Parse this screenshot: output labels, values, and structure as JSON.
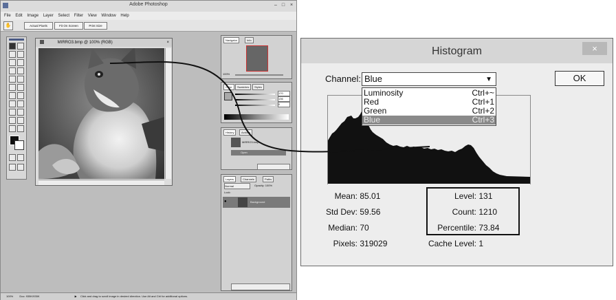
{
  "photoshop": {
    "title": "Adobe Photoshop",
    "menu": [
      "File",
      "Edit",
      "Image",
      "Layer",
      "Select",
      "Filter",
      "View",
      "Window",
      "Help"
    ],
    "options_buttons": [
      "Actual Pixels",
      "Fit On Screen",
      "Print Size"
    ],
    "document_title": "MIRRO3.bmp @ 100% (RGB)",
    "navigator_tabs": [
      "Navigator",
      "Info"
    ],
    "navigator_zoom": "100%",
    "color_tabs": [
      "Color",
      "Swatches",
      "Styles"
    ],
    "color_values": [
      "170",
      "136",
      "0"
    ],
    "history_tabs": [
      "History",
      "Actions"
    ],
    "history_items": [
      "MIRRO3.bmp",
      "Open"
    ],
    "layers_tabs": [
      "Layers",
      "Channels",
      "Paths"
    ],
    "layers_blend": "Normal",
    "layers_opacity": "Opacity: 100%",
    "layers_lock": "Lock:",
    "layer_name": "Background",
    "status_zoom": "100%",
    "status_doc": "Doc: 935K/935K",
    "status_hint": "Click and drag to scroll image in desired direction. Use Alt and Ctrl for additional options."
  },
  "histogram": {
    "title": "Histogram",
    "close_glyph": "×",
    "channel_label": "Channel:",
    "channel_value": "Blue",
    "channel_options": [
      {
        "name": "Luminosity",
        "key": "Ctrl+~"
      },
      {
        "name": "Red",
        "key": "Ctrl+1"
      },
      {
        "name": "Green",
        "key": "Ctrl+2"
      },
      {
        "name": "Blue",
        "key": "Ctrl+3"
      }
    ],
    "ok_label": "OK",
    "stats_left": [
      {
        "label": "Mean:",
        "value": "85.01"
      },
      {
        "label": "Std Dev:",
        "value": "59.56"
      },
      {
        "label": "Median:",
        "value": "70"
      },
      {
        "label": "Pixels:",
        "value": "319029"
      }
    ],
    "stats_right": [
      {
        "label": "Level:",
        "value": "131"
      },
      {
        "label": "Count:",
        "value": "1210"
      },
      {
        "label": "Percentile:",
        "value": "73.84"
      },
      {
        "label": "Cache Level:",
        "value": "1"
      }
    ]
  }
}
